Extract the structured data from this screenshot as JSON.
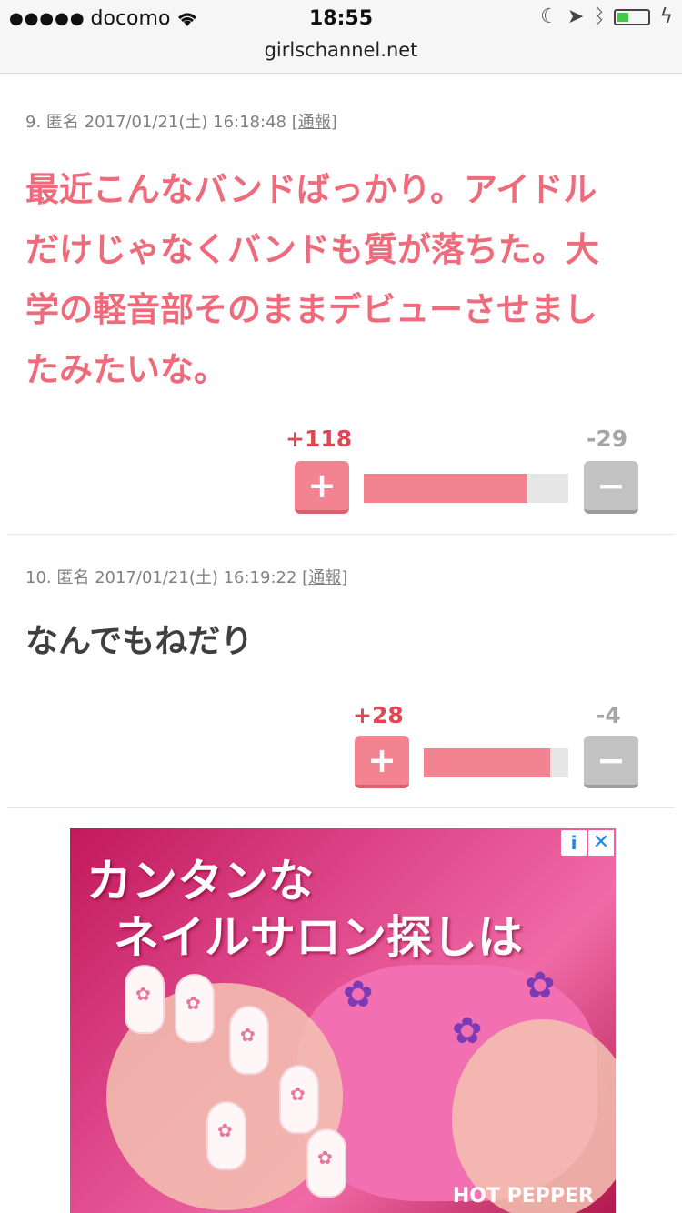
{
  "status_bar": {
    "carrier": "docomo",
    "signal_dots": "●●●●●",
    "time": "18:55",
    "url": "girlschannel.net"
  },
  "comments": [
    {
      "meta": "9. 匿名 2017/01/21(土) 16:18:48",
      "report_label": "通報",
      "text_lines": [
        "最近こんなバンドばっかり。アイドル",
        "だけじゃなくバンドも質が落ちた。大",
        "学の軽音部そのままデビューさせまし",
        "たみたいな。"
      ],
      "plus_count": "+118",
      "minus_count": "-29",
      "plus_ratio": 0.8
    },
    {
      "meta": "10. 匿名 2017/01/21(土) 16:19:22",
      "report_label": "通報",
      "text_lines": [
        "なんでもねだり"
      ],
      "plus_count": "+28",
      "minus_count": "-4",
      "plus_ratio": 0.875
    }
  ],
  "vote_buttons": {
    "plus_symbol": "+",
    "minus_symbol": "−"
  },
  "ad": {
    "line1": "カンタンな",
    "line2": "ネイルサロン探しは",
    "brand": "HOT PEPPER",
    "info_symbol": "i",
    "close_symbol": "✕"
  },
  "colors": {
    "accent_pink": "#ef6a7b",
    "plus_red": "#e14752",
    "minus_gray": "#a5a5a5"
  }
}
